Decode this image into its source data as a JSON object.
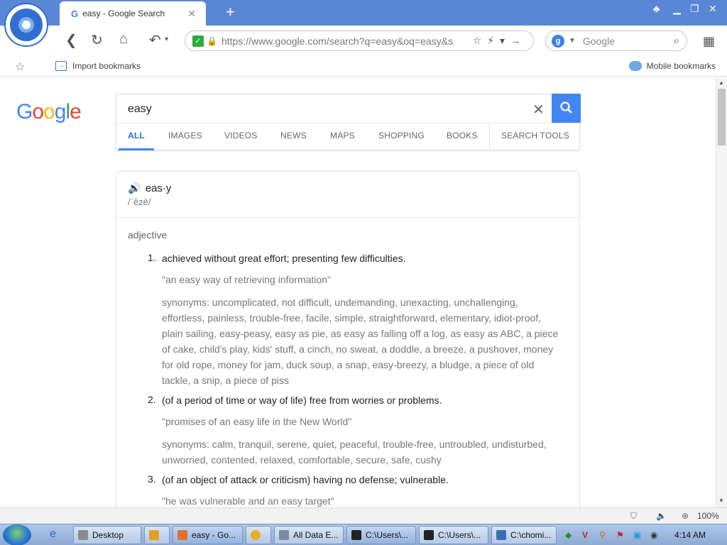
{
  "browser": {
    "tab_title": "easy - Google Search",
    "tab_favicon": "G",
    "new_tab_icon": "+",
    "address": {
      "url": "https://www.google.com/search?q=easy&oq=easy&s"
    },
    "search": {
      "engine_label": "Google"
    },
    "bookmarks": {
      "import_label": "Import bookmarks",
      "mobile_label": "Mobile bookmarks"
    }
  },
  "google": {
    "logo_letters": [
      "G",
      "o",
      "o",
      "g",
      "l",
      "e"
    ],
    "logo_colors": [
      "#4285f4",
      "#ea4335",
      "#fbbc05",
      "#4285f4",
      "#34a853",
      "#ea4335"
    ],
    "query": "easy",
    "tabs": [
      {
        "label": "ALL",
        "active": true
      },
      {
        "label": "IMAGES",
        "active": false
      },
      {
        "label": "VIDEOS",
        "active": false
      },
      {
        "label": "NEWS",
        "active": false
      },
      {
        "label": "MAPS",
        "active": false
      },
      {
        "label": "SHOPPING",
        "active": false
      },
      {
        "label": "BOOKS",
        "active": false
      },
      {
        "label": "SEARCH TOOLS",
        "active": false
      }
    ],
    "accent_color": "#4285f4"
  },
  "definition": {
    "word": "eas·y",
    "phonetic": "/ˈēzē/",
    "part_of_speech": "adjective",
    "senses": [
      {
        "number": "1.",
        "definition": "achieved without great effort; presenting few difficulties.",
        "example": "\"an easy way of retrieving information\"",
        "synonyms": "synonyms: uncomplicated, not difficult, undemanding, unexacting, unchallenging, effortless, painless, trouble-free, facile, simple, straightforward, elementary, idiot-proof, plain sailing, easy-peasy, easy as pie, as easy as falling off a log, as easy as ABC, a piece of cake, child's play, kids' stuff, a cinch, no sweat, a doddle, a breeze, a pushover, money for old rope, money for jam, duck soup, a snap, easy-breezy, a bludge, a piece of old tackle, a snip, a piece of piss"
      },
      {
        "number": "2.",
        "definition": "(of a period of time or way of life) free from worries or problems.",
        "example": "\"promises of an easy life in the New World\"",
        "synonyms": "synonyms: calm, tranquil, serene, quiet, peaceful, trouble-free, untroubled, undisturbed, unworried, contented, relaxed, comfortable, secure, safe, cushy"
      },
      {
        "number": "3.",
        "definition": "(of an object of attack or criticism) having no defense; vulnerable.",
        "example": "\"he was vulnerable and an easy target\"",
        "synonyms": ""
      }
    ]
  },
  "statusbar": {
    "zoom": "100%"
  },
  "taskbar": {
    "items": [
      {
        "label": "Desktop",
        "color": "#8a8a8a"
      },
      {
        "label": "",
        "color": "#e0a020"
      },
      {
        "label": "easy - Go...",
        "color": "#e07030"
      },
      {
        "label": "",
        "color": "#e8b020"
      },
      {
        "label": "All Data E...",
        "color": "#7a8aa0"
      },
      {
        "label": "C:\\Users\\...",
        "color": "#222222"
      },
      {
        "label": "C:\\Users\\...",
        "color": "#222222"
      },
      {
        "label": "C:\\chomi...",
        "color": "#3a6fb8"
      }
    ],
    "clock": "4:14 AM"
  }
}
